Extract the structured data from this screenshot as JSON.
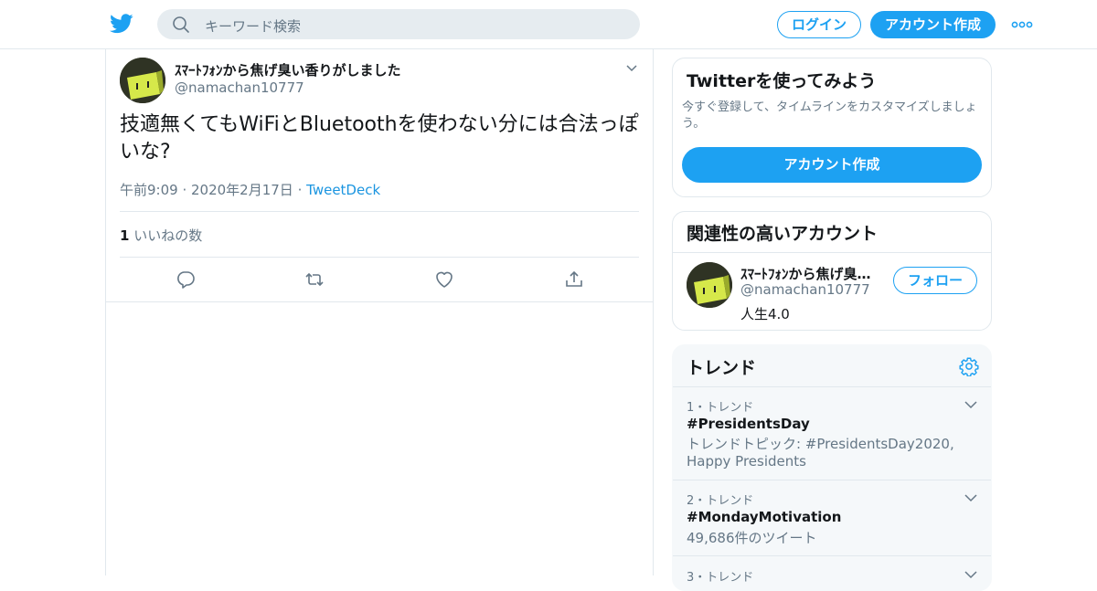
{
  "header": {
    "logo_icon": "twitter-bird-icon",
    "search_placeholder": "キーワード検索",
    "login_label": "ログイン",
    "signup_label": "アカウント作成",
    "more_icon": "more-dots-icon"
  },
  "tweet": {
    "author_name": "ｽﾏｰﾄﾌｫﾝから焦げ臭い香りがしました",
    "author_handle": "@namachan10777",
    "text": "技適無くてもWiFiとBluetoothを使わない分には合法っぽいな?",
    "time_date": "午前9:09 · 2020年2月17日",
    "separator": "·",
    "source": "TweetDeck",
    "like_count": "1",
    "like_label": "いいねの数",
    "actions": [
      "reply-icon",
      "retweet-icon",
      "like-icon",
      "share-icon"
    ]
  },
  "sidebar": {
    "signup_card": {
      "title": "Twitterを使ってみよう",
      "description": "今すぐ登録して、タイムラインをカスタマイズしましょう。",
      "button": "アカウント作成"
    },
    "related": {
      "title": "関連性の高いアカウント",
      "name": "ｽﾏｰﾄﾌｫﾝから焦げ臭い香りがしました",
      "handle": "@namachan10777",
      "bio": "人生4.0",
      "follow_label": "フォロー"
    },
    "trends": {
      "title": "トレンド",
      "items": [
        {
          "rank": "1・トレンド",
          "name": "#PresidentsDay",
          "desc": "トレンドトピック: #PresidentsDay2020, Happy Presidents"
        },
        {
          "rank": "2・トレンド",
          "name": "#MondayMotivation",
          "desc": "49,686件のツイート"
        },
        {
          "rank": "3・トレンド",
          "name": "",
          "desc": ""
        }
      ]
    }
  },
  "colors": {
    "accent": "#1da1f2",
    "secondary_text": "#657786",
    "border": "#e1e8ed",
    "trend_bg": "#f5f8fa"
  }
}
